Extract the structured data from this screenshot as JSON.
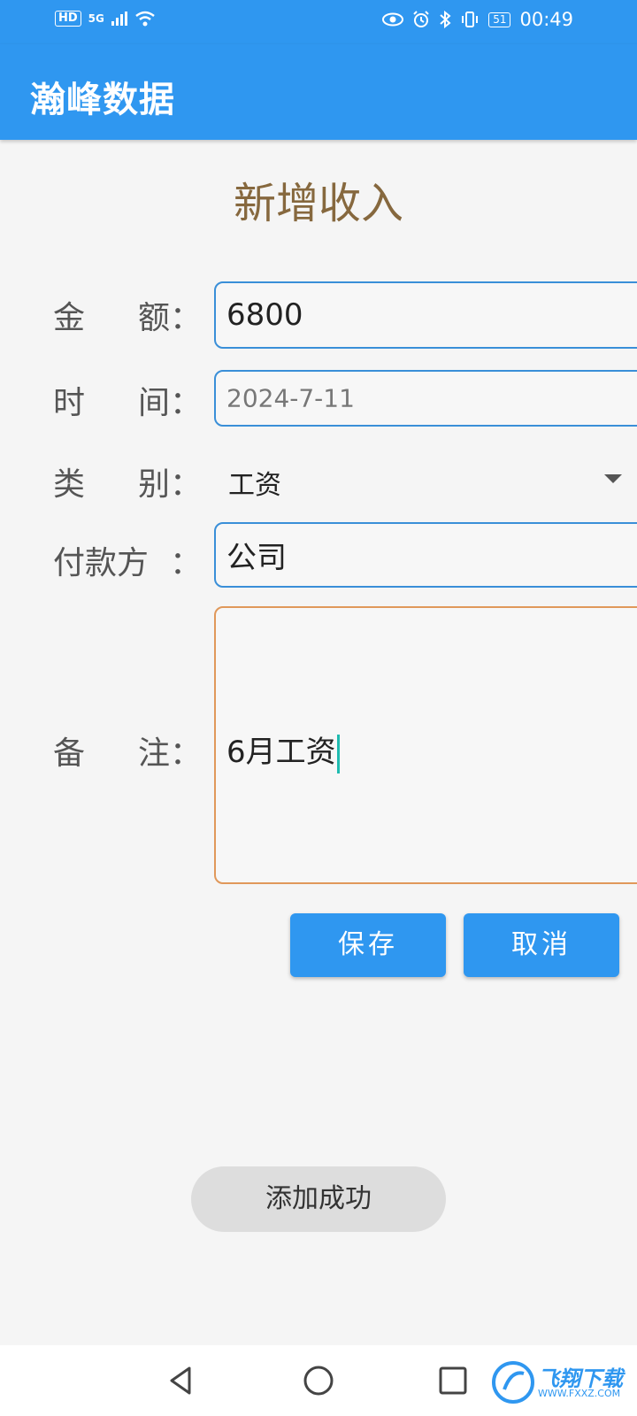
{
  "status_bar": {
    "network_badge": "HD",
    "signal": "5G",
    "battery": "51",
    "time": "00:49",
    "icons": [
      "wifi-icon",
      "eye-icon",
      "alarm-icon",
      "bluetooth-icon",
      "vibrate-icon"
    ]
  },
  "app": {
    "title": "瀚峰数据",
    "accent_color": "#2f97f0"
  },
  "form": {
    "title": "新增收入",
    "amount": {
      "label_left": "金",
      "label_right": "额：",
      "value": "6800"
    },
    "date": {
      "label_left": "时",
      "label_right": "间：",
      "value": "2024-7-11"
    },
    "category": {
      "label_left": "类",
      "label_right": "别：",
      "value": "工资"
    },
    "payer": {
      "label_left": "付款方",
      "label_right": "：",
      "value": "公司"
    },
    "memo": {
      "label_left": "备",
      "label_right": "注：",
      "value": "6月工资"
    }
  },
  "buttons": {
    "save": "保存",
    "cancel": "取消"
  },
  "toast": {
    "message": "添加成功"
  },
  "nav_bar": {
    "icons": [
      "back-icon",
      "home-icon",
      "recents-icon"
    ]
  },
  "watermark": {
    "text": "飞翔下载",
    "url": "WWW.FXXZ.COM"
  }
}
